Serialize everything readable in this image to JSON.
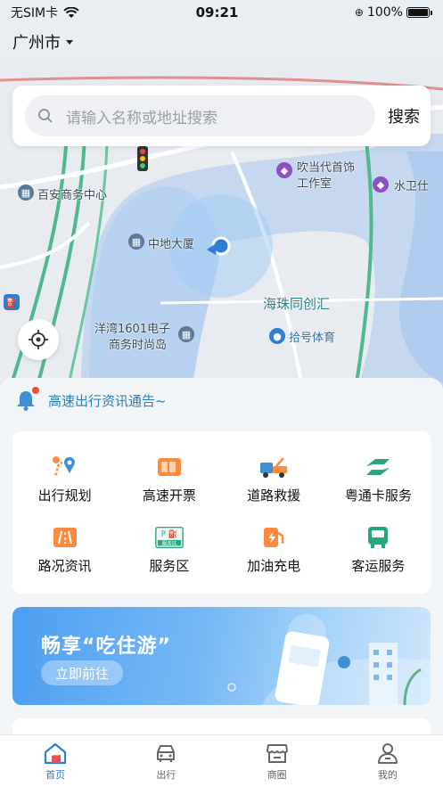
{
  "status_bar": {
    "carrier": "无SIM卡",
    "time": "09:21",
    "battery": "100%"
  },
  "city": "广州市",
  "search": {
    "placeholder": "请输入名称或地址搜索",
    "button": "搜索"
  },
  "map": {
    "labels": [
      "百安商务中心",
      "中地大厦",
      "吹当代首饰",
      "工作室",
      "水卫仕",
      "海珠同创汇",
      "洋湾1601电子",
      "商务时尚岛",
      "拾号体育"
    ]
  },
  "notice": "高速出行资讯通告~",
  "services": [
    {
      "label": "出行规划",
      "icon": "route-planning-icon"
    },
    {
      "label": "高速开票",
      "icon": "invoice-icon"
    },
    {
      "label": "道路救援",
      "icon": "tow-truck-icon"
    },
    {
      "label": "粤通卡服务",
      "icon": "yuetong-card-icon"
    },
    {
      "label": "路况资讯",
      "icon": "road-info-icon"
    },
    {
      "label": "服务区",
      "icon": "service-area-icon"
    },
    {
      "label": "加油充电",
      "icon": "fuel-charge-icon"
    },
    {
      "label": "客运服务",
      "icon": "passenger-transport-icon"
    }
  ],
  "service_area_badge": "服务区",
  "banner": {
    "title": "畅享“吃住游”",
    "button": "立即前往"
  },
  "tabs": [
    {
      "label": "首页",
      "icon": "home-icon",
      "active": true
    },
    {
      "label": "出行",
      "icon": "car-icon",
      "active": false
    },
    {
      "label": "商圈",
      "icon": "shop-icon",
      "active": false
    },
    {
      "label": "我的",
      "icon": "user-icon",
      "active": false
    }
  ],
  "colors": {
    "accent": "#2c7fd3",
    "notice": "#2b7fb8",
    "banner": "#4d9ef2"
  }
}
